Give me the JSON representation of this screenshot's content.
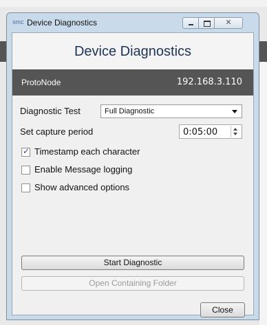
{
  "window": {
    "app_icon_text": "smc",
    "title": "Device Diagnostics",
    "controls": {
      "minimize": "",
      "maximize": "",
      "close": "✕"
    }
  },
  "header": {
    "title": "Device Diagnostics"
  },
  "device": {
    "name": "ProtoNode",
    "ip": "192.168.3.110"
  },
  "form": {
    "diagnostic_test_label": "Diagnostic Test",
    "diagnostic_test_value": "Full Diagnostic",
    "capture_period_label": "Set capture period",
    "capture_period_value": "0:05:00",
    "options": [
      {
        "label": "Timestamp each character",
        "checked": true
      },
      {
        "label": "Enable Message logging",
        "checked": false
      },
      {
        "label": "Show advanced options",
        "checked": false
      }
    ],
    "check_mark": "✓"
  },
  "buttons": {
    "start": "Start Diagnostic",
    "open_folder": "Open Containing Folder",
    "close": "Close"
  }
}
